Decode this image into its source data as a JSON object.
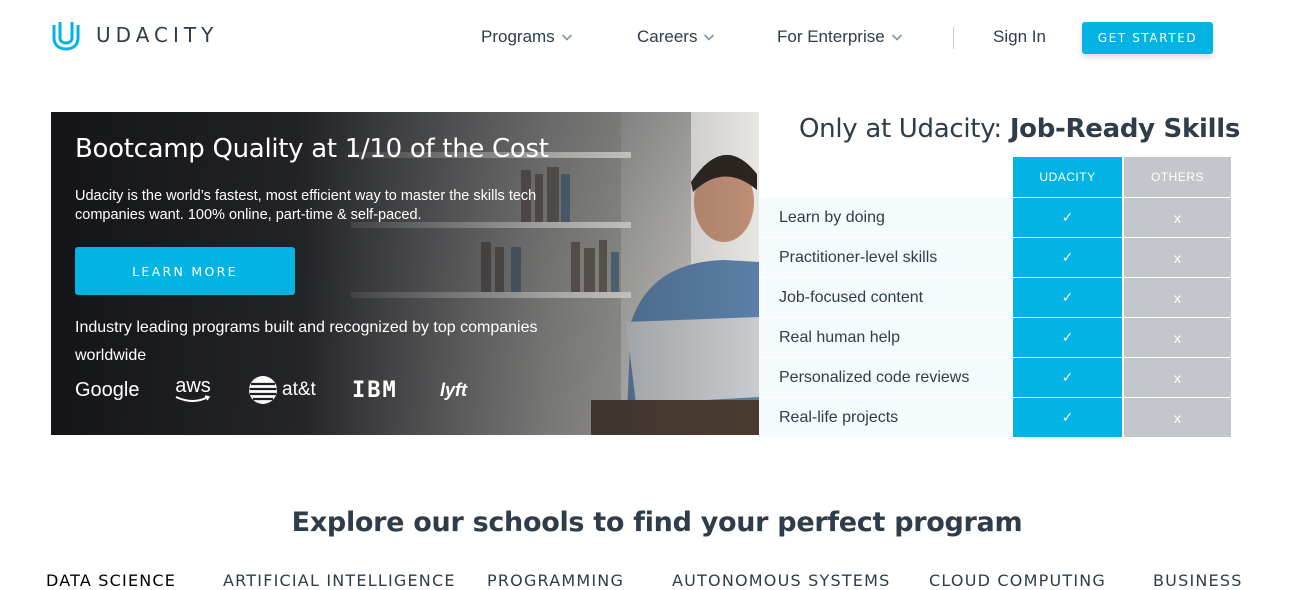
{
  "brand": {
    "name": "UDACITY",
    "accent": "#02b3e4"
  },
  "nav": {
    "items": [
      {
        "label": "Programs"
      },
      {
        "label": "Careers"
      },
      {
        "label": "For Enterprise"
      }
    ],
    "sign_in": "Sign In",
    "cta": "GET STARTED"
  },
  "hero": {
    "title": "Bootcamp Quality at 1/10 of the Cost",
    "description": "Udacity is the world’s fastest, most efficient way to master the skills tech companies want. 100% online, part-time & self-paced.",
    "button": "LEARN MORE",
    "note": "Industry leading programs built and recognized by top companies worldwide",
    "partners": [
      "Google",
      "aws",
      "at&t",
      "IBM",
      "lyft"
    ]
  },
  "comparison": {
    "title_prefix": "Only at Udacity: ",
    "title_bold": "Job-Ready Skills",
    "columns": [
      "UDACITY",
      "OTHERS"
    ],
    "rows": [
      {
        "label": "Learn by doing",
        "udacity": "✓",
        "others": "x"
      },
      {
        "label": "Practitioner-level skills",
        "udacity": "✓",
        "others": "x"
      },
      {
        "label": "Job-focused content",
        "udacity": "✓",
        "others": "x"
      },
      {
        "label": "Real human help",
        "udacity": "✓",
        "others": "x"
      },
      {
        "label": "Personalized code reviews",
        "udacity": "✓",
        "others": "x"
      },
      {
        "label": "Real-life projects",
        "udacity": "✓",
        "others": "x"
      }
    ]
  },
  "explore": {
    "title": "Explore our schools to find your perfect program",
    "schools": [
      "DATA SCIENCE",
      "ARTIFICIAL INTELLIGENCE",
      "PROGRAMMING",
      "AUTONOMOUS SYSTEMS",
      "CLOUD COMPUTING",
      "BUSINESS"
    ],
    "active": "DATA SCIENCE"
  }
}
